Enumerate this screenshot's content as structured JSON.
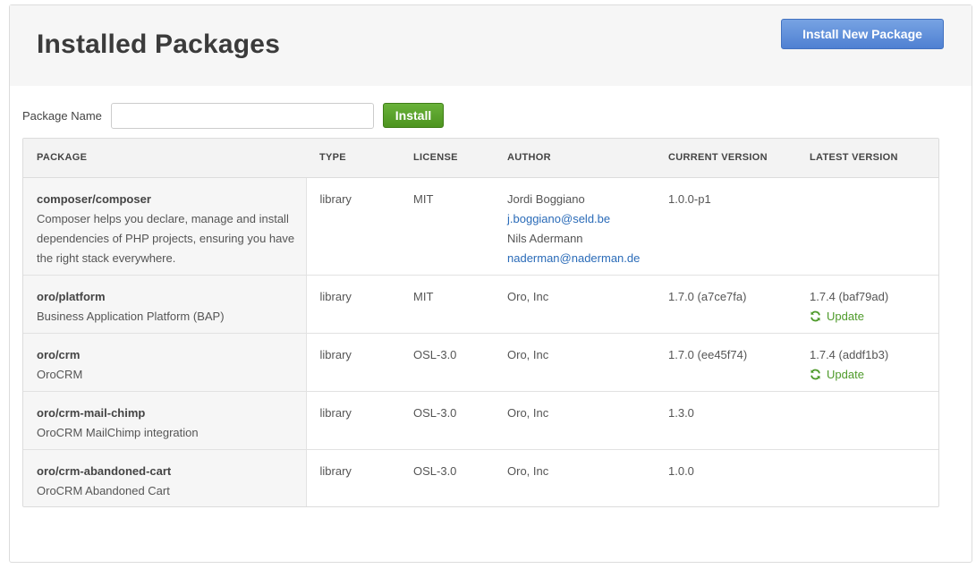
{
  "header": {
    "title": "Installed Packages",
    "install_new_label": "Install New Package"
  },
  "form": {
    "package_name_label": "Package Name",
    "package_name_value": "",
    "package_name_placeholder": "",
    "install_label": "Install"
  },
  "table": {
    "columns": [
      "PACKAGE",
      "TYPE",
      "LICENSE",
      "AUTHOR",
      "CURRENT VERSION",
      "LATEST VERSION"
    ],
    "rows": [
      {
        "name": "composer/composer",
        "description": "Composer helps you declare, manage and install dependencies of PHP projects, ensuring you have the right stack everywhere.",
        "type": "library",
        "license": "MIT",
        "authors": [
          {
            "name": "Jordi Boggiano",
            "email": "j.boggiano@seld.be"
          },
          {
            "name": "Nils Adermann",
            "email": "naderman@naderman.de"
          }
        ],
        "current_version": "1.0.0-p1",
        "latest_version": "",
        "update_label": ""
      },
      {
        "name": "oro/platform",
        "description": "Business Application Platform (BAP)",
        "type": "library",
        "license": "MIT",
        "authors": [
          {
            "name": "Oro, Inc",
            "email": ""
          }
        ],
        "current_version": "1.7.0 (a7ce7fa)",
        "latest_version": "1.7.4 (baf79ad)",
        "update_label": "Update"
      },
      {
        "name": "oro/crm",
        "description": "OroCRM",
        "type": "library",
        "license": "OSL-3.0",
        "authors": [
          {
            "name": "Oro, Inc",
            "email": ""
          }
        ],
        "current_version": "1.7.0 (ee45f74)",
        "latest_version": "1.7.4 (addf1b3)",
        "update_label": "Update"
      },
      {
        "name": "oro/crm-mail-chimp",
        "description": "OroCRM MailChimp integration",
        "type": "library",
        "license": "OSL-3.0",
        "authors": [
          {
            "name": "Oro, Inc",
            "email": ""
          }
        ],
        "current_version": "1.3.0",
        "latest_version": "",
        "update_label": ""
      },
      {
        "name": "oro/crm-abandoned-cart",
        "description": "OroCRM Abandoned Cart",
        "type": "library",
        "license": "OSL-3.0",
        "authors": [
          {
            "name": "Oro, Inc",
            "email": ""
          }
        ],
        "current_version": "1.0.0",
        "latest_version": "",
        "update_label": ""
      }
    ]
  },
  "icons": {
    "update": "refresh-icon"
  },
  "colors": {
    "primary_button": "#5b8ad8",
    "install_button": "#5aa22c",
    "link": "#2a6bb8",
    "update": "#4e9a2a"
  }
}
